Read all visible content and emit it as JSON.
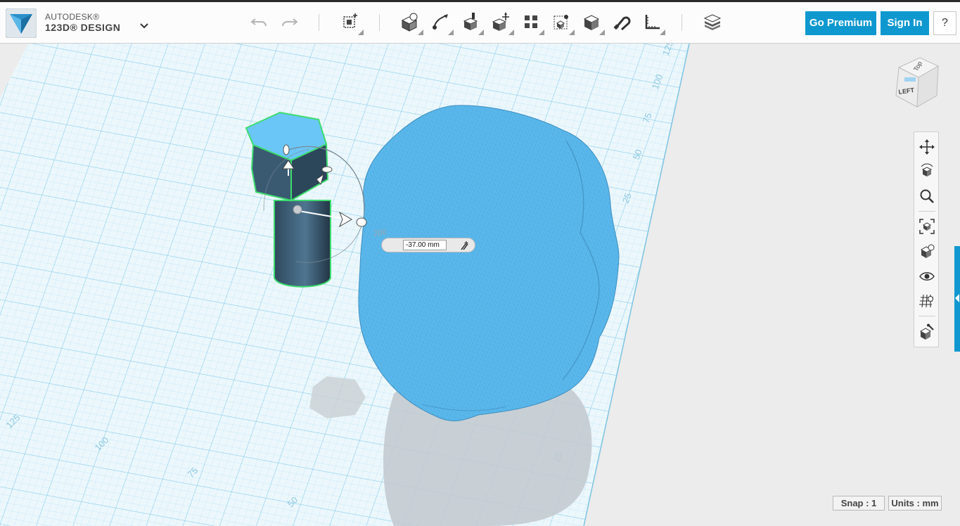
{
  "app": {
    "brand": "AUTODESK®",
    "product": "123D® DESIGN"
  },
  "toolbar": {
    "items": [
      "undo-icon",
      "redo-icon",
      "transform-icon",
      "primitives-icon",
      "sketch-icon",
      "construct-icon",
      "modify-icon",
      "pattern-icon",
      "grouping-icon",
      "combine-icon",
      "snap-icon",
      "measure-icon",
      "material-icon"
    ],
    "go_premium": "Go Premium",
    "sign_in": "Sign In",
    "help": "?"
  },
  "viewcube": {
    "top": "Top",
    "left": "LEFT"
  },
  "navbar": {
    "items": [
      "pan-icon",
      "orbit-icon",
      "zoom-icon",
      "fit-icon",
      "view-mode-icon",
      "visibility-icon",
      "grid-icon",
      "material-icon"
    ]
  },
  "move_widget": {
    "distance_value": "-37.00 mm",
    "angle_label": "200"
  },
  "grid_labels": {
    "right": [
      "125",
      "100",
      "75",
      "50",
      "25"
    ],
    "bottom": [
      "125",
      "100",
      "75",
      "50"
    ],
    "mesh": [
      "50",
      "25"
    ]
  },
  "status": {
    "snap": "Snap : 1",
    "units": "Units : mm"
  },
  "colors": {
    "accent": "#0f98cf",
    "model": "#5ab8ec",
    "grid_line": "#9ad5ec",
    "selection": "#3ddc6f"
  }
}
